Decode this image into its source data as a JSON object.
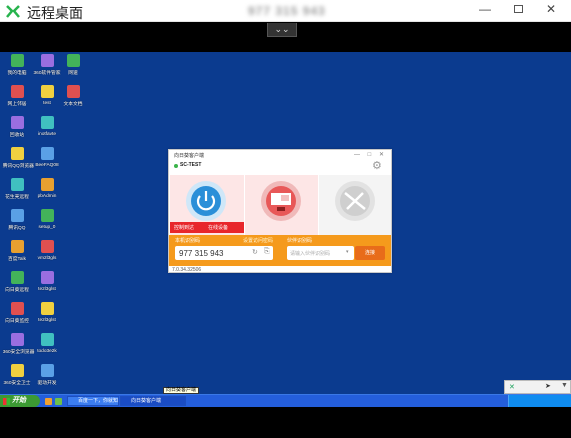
{
  "window": {
    "title": "远程桌面",
    "remote_id": "977 315 943",
    "controls": {
      "minimize": "—",
      "close": "✕"
    },
    "toolbar_toggle": "⌄⌄"
  },
  "desktop": {
    "background_color": "#0b3b8f",
    "icons_col1": [
      "我的电脑",
      "网上邻居",
      "回收站",
      "腾讯QQ浏览器",
      "花生壳远程",
      "腾讯QQ",
      "百度Talk",
      "向日葵远程",
      "向日葵监控",
      "360安全浏览器",
      "360安全卫士"
    ],
    "icons_col2": [
      "360软件管家",
      "test",
      "inotfavte",
      "BeeFAQ08",
      "pbAdmin",
      "setup_0",
      "vm2l3gls",
      "te2l3glst",
      "te2l3glst",
      "todo3e2k",
      "驱动开发"
    ],
    "icons_col3": [
      "网速",
      "文本文档"
    ]
  },
  "client": {
    "title": "向日葵客户端",
    "device": "SC-TEST",
    "alert_left": "控制到达",
    "alert_right": "在线设备",
    "local_label": "本机识别码",
    "set_pwd_label": "设置访问密码",
    "remote_label": "伙伴识别码",
    "local_id": "977 315 943",
    "refresh_icon": "↻",
    "copy_icon": "⎘",
    "code_placeholder": "请输入伙伴识别码",
    "connect": "连接",
    "version": "7.0.34.32506"
  },
  "taskbar": {
    "start": "开始",
    "tasks": [
      "百度一下，你就知",
      "向日葵客户端"
    ],
    "tooltip": "向日葵客户端"
  },
  "mini_panel": {
    "x_icon": "✕",
    "cursor_icon": "➤",
    "pin_icon": "▼"
  }
}
